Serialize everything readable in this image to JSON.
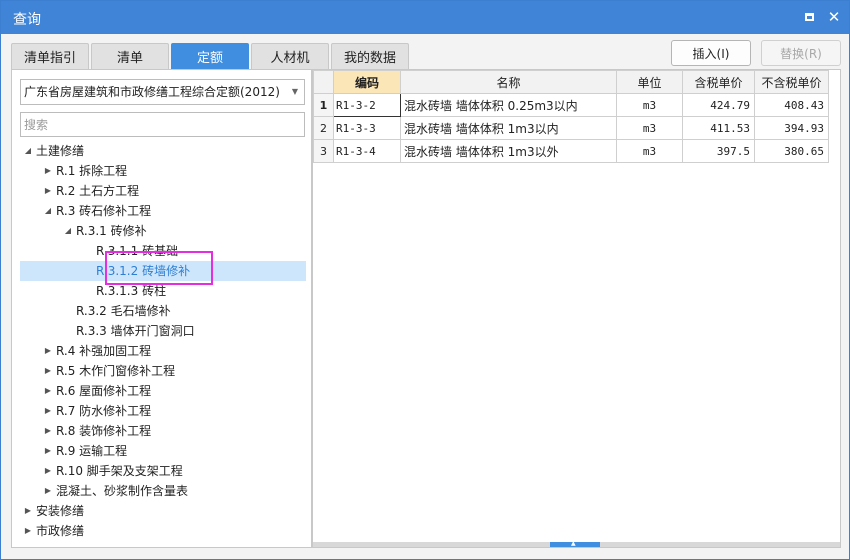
{
  "window": {
    "title": "查询",
    "accent": "#3f84d6"
  },
  "tabs": [
    {
      "label": "清单指引",
      "active": false
    },
    {
      "label": "清单",
      "active": false
    },
    {
      "label": "定额",
      "active": true
    },
    {
      "label": "人材机",
      "active": false
    },
    {
      "label": "我的数据",
      "active": false
    }
  ],
  "toolbar": {
    "insert_label": "插入(I)",
    "replace_label": "替换(R)"
  },
  "left": {
    "combo_value": "广东省房屋建筑和市政修缮工程综合定额(2012)",
    "search_placeholder": "搜索",
    "tree": [
      {
        "label": "土建修缮",
        "toggle": "◢"
      },
      {
        "label": "R.1 拆除工程",
        "toggle": "▶"
      },
      {
        "label": "R.2 土石方工程",
        "toggle": "▶"
      },
      {
        "label": "R.3 砖石修补工程",
        "toggle": "◢"
      },
      {
        "label": "R.3.1 砖修补",
        "toggle": "◢"
      },
      {
        "label": "R.3.1.1 砖基础",
        "toggle": ""
      },
      {
        "label": "R.3.1.2 砖墙修补",
        "toggle": ""
      },
      {
        "label": "R.3.1.3 砖柱",
        "toggle": ""
      },
      {
        "label": "R.3.2 毛石墙修补",
        "toggle": ""
      },
      {
        "label": "R.3.3 墙体开门窗洞口",
        "toggle": ""
      },
      {
        "label": "R.4 补强加固工程",
        "toggle": "▶"
      },
      {
        "label": "R.5 木作门窗修补工程",
        "toggle": "▶"
      },
      {
        "label": "R.6 屋面修补工程",
        "toggle": "▶"
      },
      {
        "label": "R.7 防水修补工程",
        "toggle": "▶"
      },
      {
        "label": "R.8 装饰修补工程",
        "toggle": "▶"
      },
      {
        "label": "R.9 运输工程",
        "toggle": "▶"
      },
      {
        "label": "R.10 脚手架及支架工程",
        "toggle": "▶"
      },
      {
        "label": "混凝土、砂浆制作含量表",
        "toggle": "▶"
      },
      {
        "label": "安装修缮",
        "toggle": "▶"
      },
      {
        "label": "市政修缮",
        "toggle": "▶"
      }
    ]
  },
  "table": {
    "headers": [
      "编码",
      "名称",
      "单位",
      "含税单价",
      "不含税单价"
    ],
    "rows": [
      {
        "idx": "1",
        "code": "R1-3-2",
        "name": "混水砖墙 墙体体积 0.25m3以内",
        "unit": "m3",
        "price_tax": "424.79",
        "price_notax": "408.43"
      },
      {
        "idx": "2",
        "code": "R1-3-3",
        "name": "混水砖墙 墙体体积 1m3以内",
        "unit": "m3",
        "price_tax": "411.53",
        "price_notax": "394.93"
      },
      {
        "idx": "3",
        "code": "R1-3-4",
        "name": "混水砖墙 墙体体积 1m3以外",
        "unit": "m3",
        "price_tax": "397.5",
        "price_notax": "380.65"
      }
    ]
  }
}
